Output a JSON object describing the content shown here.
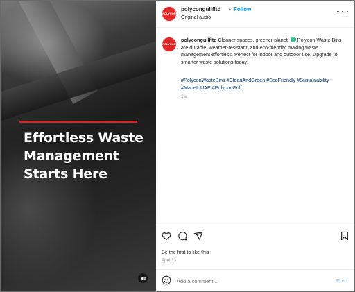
{
  "post": {
    "media": {
      "headline_lines": [
        "Effortless Waste",
        "Management",
        "Starts Here"
      ],
      "accent_color": "#d6232a",
      "mute_icon": "speaker-muted-icon"
    },
    "header": {
      "avatar_text": "POLYCON",
      "username": "polyconguilfltd",
      "separator": "•",
      "follow_label": "Follow",
      "audio_label": "Original audio",
      "more_icon": "more-options-icon"
    },
    "caption": {
      "username": "polyconguilfltd",
      "text_before_emoji": " Cleaner spaces, greener planet! ",
      "text_after_emoji": " Polycon Waste Bins are durable, weather-resistant, and eco-friendly, making waste management effortless. Perfect for indoor and outdoor use. Upgrade to smarter waste solutions today!",
      "hashtags": [
        "#PolyconWasteBins",
        "#CleanAndGreen",
        "#EcoFriendly",
        "#Sustainability",
        "#MadeInUAE",
        "#PolyconGulf"
      ],
      "age": "3w"
    },
    "actions": {
      "like_icon": "heart-icon",
      "comment_icon": "comment-icon",
      "share_icon": "share-icon",
      "save_icon": "bookmark-icon"
    },
    "likes_text": "Be the first to like this",
    "date": "April 13",
    "comment_box": {
      "emoji_icon": "emoji-icon",
      "placeholder": "Add a comment...",
      "post_label": "Post"
    },
    "colors": {
      "link_blue": "#0095f6",
      "hashtag_blue": "#00376b",
      "post_disabled": "#b3dbff",
      "avatar_red": "#e02a2a"
    }
  }
}
